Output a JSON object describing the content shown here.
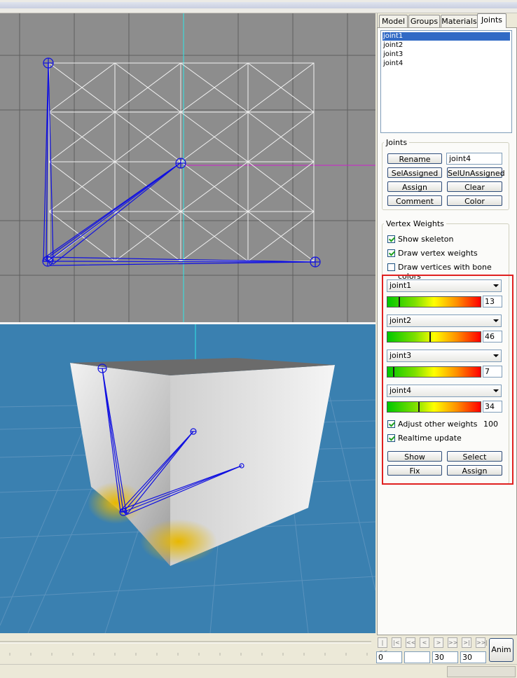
{
  "tabs": [
    {
      "label": "Model"
    },
    {
      "label": "Groups"
    },
    {
      "label": "Materials"
    },
    {
      "label": "Joints"
    }
  ],
  "joint_list": [
    "joint1",
    "joint2",
    "joint3",
    "joint4"
  ],
  "selected_joint": "joint1",
  "joints_group": {
    "title": "Joints",
    "name_value": "joint4",
    "rename": "Rename",
    "sel_assigned": "SelAssigned",
    "sel_unassigned": "SelUnAssigned",
    "assign": "Assign",
    "clear": "Clear",
    "comment": "Comment",
    "color": "Color"
  },
  "vertex_weights": {
    "title": "Vertex Weights",
    "show_skeleton": {
      "label": "Show skeleton",
      "checked": true
    },
    "draw_vertex_weights": {
      "label": "Draw vertex weights",
      "checked": true
    },
    "draw_bone_colors": {
      "label": "Draw vertices with bone colors",
      "checked": false
    },
    "weights": [
      {
        "joint": "joint1",
        "value": "13"
      },
      {
        "joint": "joint2",
        "value": "46"
      },
      {
        "joint": "joint3",
        "value": "7"
      },
      {
        "joint": "joint4",
        "value": "34"
      }
    ],
    "adjust_other": {
      "label": "Adjust other weights",
      "checked": true,
      "value": "100"
    },
    "realtime": {
      "label": "Realtime update",
      "checked": true
    },
    "show": "Show",
    "select": "Select",
    "fix": "Fix",
    "assign": "Assign"
  },
  "timeline": {
    "buttons": [
      "|<<",
      "|<",
      "<<",
      "<",
      ">",
      ">>",
      ">|",
      ">>|"
    ],
    "frame": "0",
    "blank": "",
    "fps": "30",
    "frames": "30",
    "anim": "Anim"
  },
  "colors": {
    "viewport_top_bg": "#8d8d8d",
    "viewport_bottom_bg": "#3a80b0",
    "bone": "#1010e0",
    "highlight": "#e02020"
  }
}
